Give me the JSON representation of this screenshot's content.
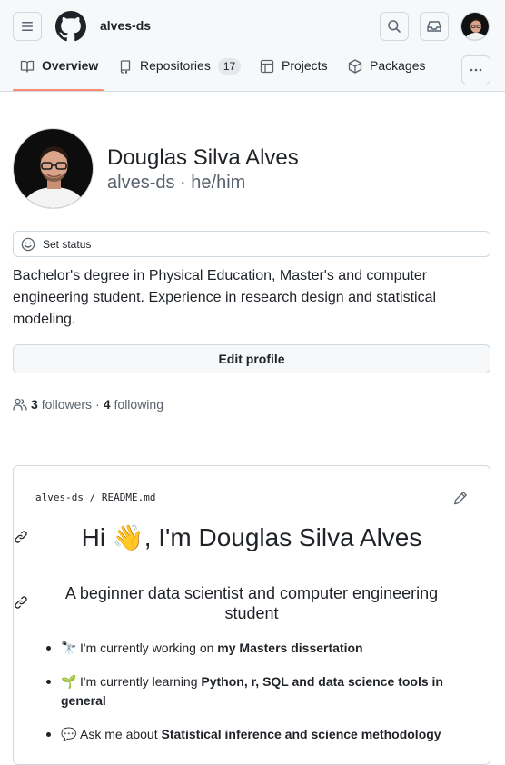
{
  "header": {
    "owner": "alves-ds",
    "tabs": [
      {
        "label": "Overview",
        "icon": "book-icon",
        "active": true
      },
      {
        "label": "Repositories",
        "icon": "repo-icon",
        "count": "17"
      },
      {
        "label": "Projects",
        "icon": "table-icon"
      },
      {
        "label": "Packages",
        "icon": "package-icon"
      }
    ]
  },
  "profile": {
    "name": "Douglas Silva Alves",
    "login": "alves-ds",
    "pronouns": "he/him",
    "status_label": "Set status",
    "bio": "Bachelor's degree in Physical Education, Master's and computer engineering student. Experience in research design and statistical modeling.",
    "edit_label": "Edit profile",
    "followers_count": "3",
    "followers_label": "followers",
    "following_count": "4",
    "following_label": "following"
  },
  "readme": {
    "owner": "alves-ds",
    "separator": "/",
    "file": "README.md",
    "heading": "Hi 👋, I'm Douglas Silva Alves",
    "subheading": "A beginner data scientist and computer engineering student",
    "items": [
      {
        "emoji": "🔭",
        "text": "I'm currently working on ",
        "bold": "my Masters dissertation"
      },
      {
        "emoji": "🌱",
        "text": "I'm currently learning ",
        "bold": "Python, r, SQL and data science tools in general"
      },
      {
        "emoji": "💬",
        "text": "Ask me about ",
        "bold": "Statistical inference and science methodology"
      }
    ]
  },
  "colors": {
    "accent_underline": "#fd8c73",
    "border": "#d1d9e0",
    "muted_text": "#59636e",
    "header_bg": "#f6f8fa"
  }
}
